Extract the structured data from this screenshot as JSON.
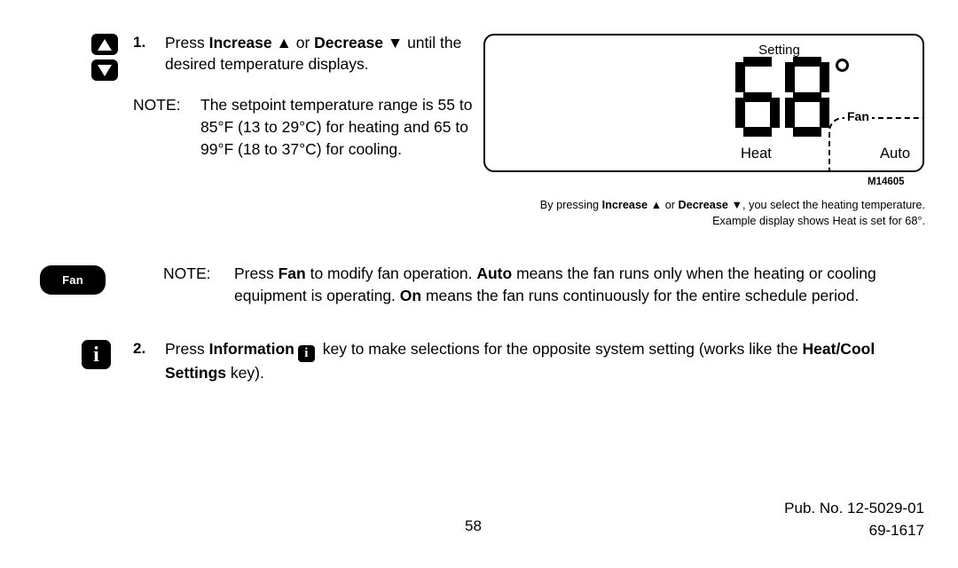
{
  "step1": {
    "number": "1.",
    "text_lead": "Press ",
    "bold_increase": "Increase",
    "arrow_up": "▲",
    "mid": " or ",
    "bold_decrease": "Decrease",
    "arrow_down": "▼",
    "text_tail": " until the desired temperature displays.",
    "note_label": "NOTE:",
    "note_text": "The setpoint temperature range is 55 to 85°F (13 to 29°C) for heating and 65 to 99°F (18 to 37°C) for cooling."
  },
  "keys": {
    "increase_icon": "triangle-up-icon",
    "decrease_icon": "triangle-down-icon",
    "fan_label": "Fan",
    "info_glyph": "i"
  },
  "lcd": {
    "setting_label": "Setting",
    "temperature": "68",
    "degree_symbol": "°",
    "mode_label": "Heat",
    "fan_label": "Fan",
    "fan_mode": "Auto",
    "figure_id": "M14605"
  },
  "caption": {
    "lead": "By pressing ",
    "bold_increase": "Increase",
    "arrow_up": "▲",
    "mid": " or ",
    "bold_decrease": "Decrease",
    "arrow_down": "▼",
    "tail": ", you select the heating temperature. Example display shows Heat is set for 68°."
  },
  "note_fan": {
    "label": "NOTE:",
    "lead": "Press ",
    "bold_fan": "Fan",
    "mid1": " to modify fan operation. ",
    "bold_auto": "Auto",
    "mid2": " means the fan runs only when the heating or cooling equipment is operating. ",
    "bold_on": "On",
    "tail": " means the fan runs continuously for the entire schedule period."
  },
  "step2": {
    "number": "2.",
    "lead": "Press ",
    "bold_information": "Information",
    "mid": " key to make selections for the opposite system setting (works like the ",
    "bold_heatcool": "Heat/Cool Settings",
    "tail": " key)."
  },
  "footer": {
    "pub_line1": "Pub. No. 12-5029-01",
    "pub_line2": "69-1617",
    "page_number": "58"
  }
}
